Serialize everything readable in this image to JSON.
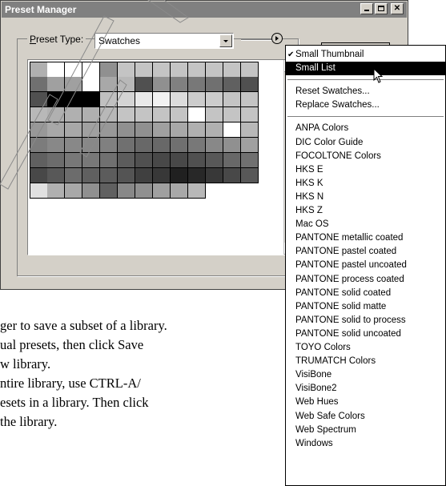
{
  "window": {
    "title": "Preset Manager"
  },
  "preset_type": {
    "label_prefix": "P",
    "label_rest": "reset Type:",
    "value": "Swatches"
  },
  "swatches": {
    "rows": [
      [
        "#b0b0b0",
        "#ffffff",
        "#ffffff",
        "#ffffff",
        "#909090",
        "#c4c4c4",
        "#c4c4c4",
        "#c4c4c4",
        "#c4c4c4",
        "#c4c4c4",
        "#c4c4c4",
        "#c4c4c4",
        "#c4c4c4"
      ],
      [
        "#707070",
        "#a0a0a0",
        "#a0a0a0",
        "#ffffff",
        "#a8a8a8",
        "#b8b8b8",
        "#505050",
        "#909090",
        "#808080",
        "#787878",
        "#707070",
        "#606060",
        "#505050"
      ],
      [
        "#505050",
        "#000000",
        "#000000",
        "#000000",
        "#c0c0c0",
        "#d4d4d4",
        "#e8e8e8",
        "#f2f2f2",
        "#dcdcdc",
        "#cccccc",
        "#cccccc",
        "#c4c4c4",
        "#c4c4c4"
      ],
      [
        "#b8b8b8",
        "#b0b0b0",
        "#b0b0b0",
        "#b0b0b0",
        "#b8b8b8",
        "#c4c4c4",
        "#c4c4c4",
        "#c4c4c4",
        "#c4c4c4",
        "#ffffff",
        "#c4c4c4",
        "#c4c4c4",
        "#c4c4c4"
      ],
      [
        "#989898",
        "#a8a8a8",
        "#a8a8a8",
        "#a0a0a0",
        "#989898",
        "#909090",
        "#909090",
        "#a0a0a0",
        "#a8a8a8",
        "#b0b0b0",
        "#b0b0b0",
        "#ffffff",
        "#b8b8b8"
      ],
      [
        "#7c7c7c",
        "#888888",
        "#888888",
        "#888888",
        "#808080",
        "#707070",
        "#686868",
        "#686868",
        "#707070",
        "#787878",
        "#888888",
        "#909090",
        "#a0a0a0"
      ],
      [
        "#606060",
        "#6c6c6c",
        "#787878",
        "#787878",
        "#707070",
        "#5c5c5c",
        "#505050",
        "#484848",
        "#484848",
        "#505050",
        "#585858",
        "#686868",
        "#707070"
      ],
      [
        "#484848",
        "#585858",
        "#6c6c6c",
        "#606060",
        "#5c5c5c",
        "#545454",
        "#404040",
        "#383838",
        "#202020",
        "#282828",
        "#383838",
        "#484848",
        "#585858"
      ],
      [
        "#e0e0e0",
        "#b0b0b0",
        "#a8a8a8",
        "#909090",
        "#606060",
        "#888888",
        "#909090",
        "#a0a0a0",
        "#a8a8a8",
        "#b8b8b8"
      ]
    ]
  },
  "caption": {
    "line1": "ger to save a subset of a library.",
    "line2": "ual presets, then click Save",
    "line3": "w library.",
    "line4_pre": "ntire library, use ",
    "line4_key": "CTRL-A/",
    "line5": "esets in a library. Then click",
    "line6": "the library."
  },
  "menu": {
    "check_mark": "✔",
    "top_items": [
      "Small Thumbnail",
      "Small List"
    ],
    "checked_index": 0,
    "highlighted_index": 1,
    "actions": [
      "Reset Swatches...",
      "Replace Swatches..."
    ],
    "libraries": [
      "ANPA Colors",
      "DIC Color Guide",
      "FOCOLTONE Colors",
      "HKS E",
      "HKS K",
      "HKS N",
      "HKS Z",
      "Mac OS",
      "PANTONE metallic coated",
      "PANTONE pastel coated",
      "PANTONE pastel uncoated",
      "PANTONE process coated",
      "PANTONE solid coated",
      "PANTONE solid matte",
      "PANTONE solid to process",
      "PANTONE solid uncoated",
      "TOYO Colors",
      "TRUMATCH Colors",
      "VisiBone",
      "VisiBone2",
      "Web Hues",
      "Web Safe Colors",
      "Web Spectrum",
      "Windows"
    ]
  }
}
